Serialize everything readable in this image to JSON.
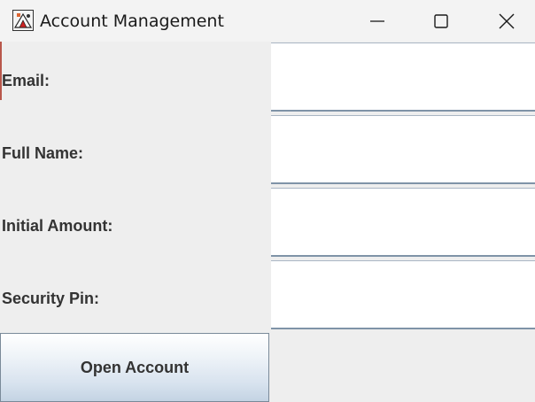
{
  "window": {
    "title": "Account Management",
    "icons": {
      "app": "java-coffee-cup-icon",
      "minimize": "minimize-icon",
      "maximize": "maximize-icon",
      "close": "close-icon"
    }
  },
  "form": {
    "fields": [
      {
        "label": "Email:",
        "value": ""
      },
      {
        "label": "Full Name:",
        "value": ""
      },
      {
        "label": "Initial Amount:",
        "value": ""
      },
      {
        "label": "Security Pin:",
        "value": ""
      }
    ],
    "submit_label": "Open Account"
  },
  "colors": {
    "background": "#eeeeee",
    "titlebar": "#f3f3f3",
    "label_text": "#333333",
    "field_border": "#7f93a7"
  }
}
